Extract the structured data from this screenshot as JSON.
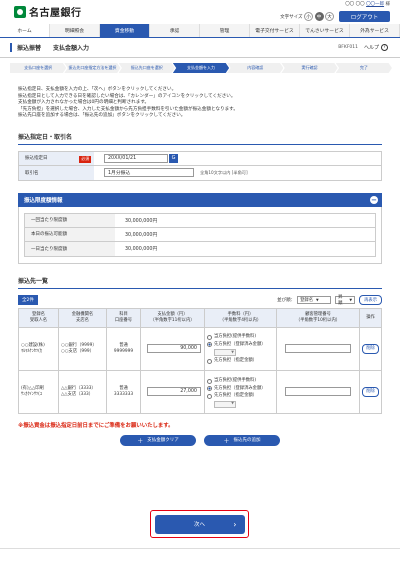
{
  "header": {
    "bank_name": "名古屋銀行",
    "user_prefix": "〇〇 〇〇",
    "user_name": "〇〇一郎",
    "user_suffix": "様",
    "last_login": "前回ログイン日時 20XX年01月20日 10時00分00秒",
    "font_size_label": "文字サイズ",
    "font_size_options": [
      "小",
      "中",
      "大"
    ],
    "logout_label": "ログアウト"
  },
  "gnav": [
    "ホーム",
    "明細照会",
    "資金移動",
    "承認",
    "管理",
    "電子交付サービス",
    "でんさいサービス",
    "外為サービス"
  ],
  "page": {
    "title": "振込振替",
    "subtitle": "支払金額入力",
    "code": "BFKF011",
    "help": "ヘルプ",
    "help_icon": "?"
  },
  "steps": [
    "支払口座を選択",
    "振込先口座指定方法を選択",
    "振込先口座を選択",
    "支払金額を入力",
    "内容確認",
    "実行確認",
    "完了"
  ],
  "intro": [
    "振込指定日、支払金額を入力の上、「次へ」ボタンをクリックしてください。",
    "振込指定日として入力できる日を確認したい場合は、「カレンダー」のアイコンをクリックしてください。",
    "支払金額が入力されなかった場合は0円の明細と判断されます。",
    "「先方負担」を選択した場合、入力した支払金額から先方負担手数料を引いた金額が振込金額となります。",
    "振込先口座を追加する場合は、「振込先の追加」ボタンをクリックしてください。"
  ],
  "section1": {
    "title": "振込指定日・取引名",
    "date_label": "振込指定日",
    "required": "必須",
    "date_value": "20XX/01/21",
    "cal_icon": "G",
    "name_label": "取引名",
    "name_value": "1月分振込",
    "name_note": "全角10文字以内 [半角可]"
  },
  "limits": {
    "title": "振込限度額情報",
    "toggle": "−",
    "rows": [
      {
        "label": "一回当たり限度額",
        "value": "30,000,000円"
      },
      {
        "label": "本日の振込可能額",
        "value": "30,000,000円"
      },
      {
        "label": "一日当たり限度額",
        "value": "30,000,000円"
      }
    ]
  },
  "payees": {
    "title": "振込先一覧",
    "all_label": "全2件",
    "sort_label": "並び順：",
    "sort_value": "登録名",
    "order_value": "昇順",
    "resort": "再表示",
    "headers": [
      [
        "登録名",
        "受取人名"
      ],
      [
        "金融機関名",
        "支店名"
      ],
      [
        "科目",
        "口座番号"
      ],
      [
        "支払金額（円）",
        "（半角数字11桁以内）"
      ],
      [
        "手数料（円）",
        "（半角数字4桁以内）"
      ],
      [
        "顧客管理番号",
        "（半角数字10桁以内）"
      ],
      [
        "操作"
      ]
    ],
    "rows": [
      {
        "reg": "○○建設(株)",
        "recv": "ﾏﾙﾏﾙｹﾝｾﾂ(ｶ",
        "bank": "○○銀行（9999）",
        "branch": "○○支店（999）",
        "type": "普通",
        "acct": "9999999",
        "amount": "90,000",
        "fee_opts": [
          "当方負担(提供手数料)",
          "先方負担（登録済み金額）",
          "先方負担（指定金額）"
        ],
        "fee_sel": 1,
        "del": "削除"
      },
      {
        "reg": "(有)△△印刷",
        "recv": "ｻﾝｶｸｲﾝｻﾂ(ﾕ",
        "bank": "△△銀行（3333）",
        "branch": "△△支店（333）",
        "type": "普通",
        "acct": "3333333",
        "amount": "27,000",
        "fee_opts": [
          "当方負担(提供手数料)",
          "先方負担（登録済み金額）",
          "先方負担（指定金額）"
        ],
        "fee_sel": 1,
        "del": "削除"
      }
    ]
  },
  "warning": "※振込資金は振込指定日前日までにご準備をお願いいたします。",
  "buttons": {
    "clear": "支払金額クリア",
    "add": "振込先の追加",
    "plus": "＋",
    "next": "次へ",
    "next_arrow": "›"
  }
}
